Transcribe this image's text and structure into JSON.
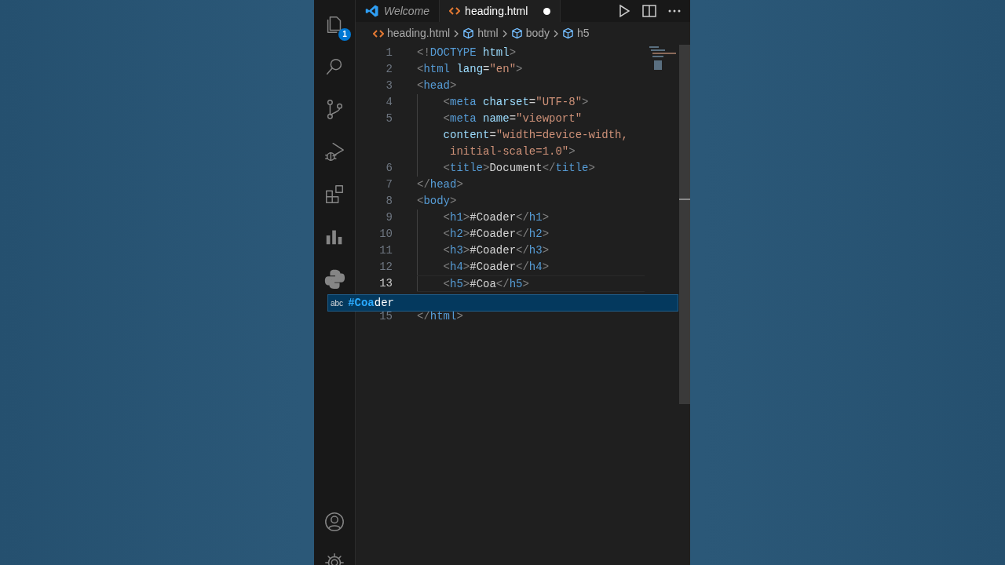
{
  "activity_bar": {
    "items": [
      {
        "kind": "explorer",
        "badge": "1"
      },
      {
        "kind": "search"
      },
      {
        "kind": "source-control"
      },
      {
        "kind": "run-debug"
      },
      {
        "kind": "extensions"
      },
      {
        "kind": "chart"
      },
      {
        "kind": "python"
      }
    ],
    "bottom": [
      {
        "kind": "account"
      },
      {
        "kind": "settings"
      }
    ]
  },
  "tabs": [
    {
      "label": "Welcome",
      "kind": "welcome",
      "selected": false,
      "dirty": false
    },
    {
      "label": "heading.html",
      "kind": "html",
      "selected": true,
      "dirty": true
    }
  ],
  "tab_actions": [
    {
      "kind": "run"
    },
    {
      "kind": "split"
    },
    {
      "kind": "more"
    }
  ],
  "breadcrumbs": [
    {
      "label": "heading.html",
      "kind": "file"
    },
    {
      "label": "html",
      "kind": "element"
    },
    {
      "label": "body",
      "kind": "element"
    },
    {
      "label": "h5",
      "kind": "element"
    }
  ],
  "editor": {
    "lines": [
      {
        "number": "1",
        "current": false,
        "text": "<!DOCTYPE html>"
      },
      {
        "number": "2",
        "current": false,
        "text": "<html lang=\"en\">"
      },
      {
        "number": "3",
        "current": false,
        "text": "<head>"
      },
      {
        "number": "4",
        "current": false,
        "text": "    <meta charset=\"UTF-8\">"
      },
      {
        "number": "5",
        "current": false,
        "text": "    <meta name=\"viewport\""
      },
      {
        "current": false,
        "text": "    content=\"width=device-width,"
      },
      {
        "current": false,
        "text": "     initial-scale=1.0\">"
      },
      {
        "number": "6",
        "current": false,
        "text": "    <title>Document</title>"
      },
      {
        "number": "7",
        "current": false,
        "text": "</head>"
      },
      {
        "number": "8",
        "current": false,
        "text": "<body>"
      },
      {
        "number": "9",
        "current": false,
        "text": "    <h1>#Coader</h1>"
      },
      {
        "number": "10",
        "current": false,
        "text": "    <h2>#Coader</h2>"
      },
      {
        "number": "11",
        "current": false,
        "text": "    <h3>#Coader</h3>"
      },
      {
        "number": "12",
        "current": false,
        "text": "    <h4>#Coader</h4>"
      },
      {
        "number": "13",
        "current": true,
        "text": "    <h5>#Coa</h5>"
      },
      {
        "number": "15",
        "current": false,
        "text": "</html>"
      }
    ]
  },
  "suggestion": {
    "type_label": "abc",
    "match": "#Coa",
    "rest": "der",
    "selected": true
  }
}
